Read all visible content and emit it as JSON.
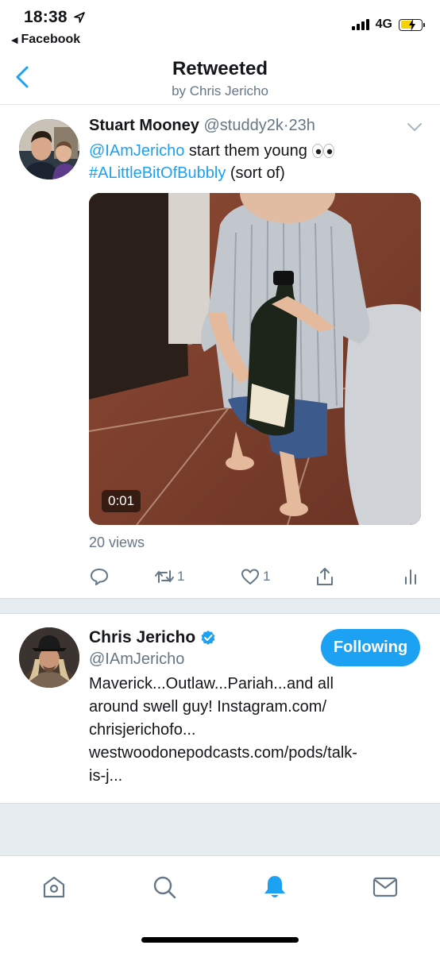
{
  "status_bar": {
    "time": "18:38",
    "back_app": "Facebook",
    "network": "4G",
    "location_icon": "location-arrow-icon",
    "battery_color": "#f5d300"
  },
  "header": {
    "title": "Retweeted",
    "subtitle": "by Chris Jericho"
  },
  "tweet": {
    "author_name": "Stuart Mooney",
    "author_handle": "@studdy2k",
    "separator": "·",
    "time": "23h",
    "mention": "@IAmJericho",
    "text_part": " start them young ",
    "hashtag": "#ALittleBitOfBubbly",
    "text_end": " (sort of)",
    "video_duration": "0:01",
    "views": "20 views",
    "retweet_count": "1",
    "like_count": "1"
  },
  "profile": {
    "name": "Chris Jericho",
    "handle": "@IAmJericho",
    "follow_label": "Following",
    "bio_lines": [
      "Maverick...Outlaw...Pariah...and all",
      "around swell guy! Instagram.com/",
      "chrisjerichofo...",
      "westwoodonepodcasts.com/pods/talk-",
      "is-j..."
    ]
  },
  "tabbar": {
    "tabs": [
      "home-icon",
      "search-icon",
      "notifications-icon",
      "messages-icon"
    ],
    "active": "notifications-icon"
  },
  "colors": {
    "accent": "#1da1f2",
    "secondary_text": "#657786",
    "divider": "#e6ecf0"
  }
}
